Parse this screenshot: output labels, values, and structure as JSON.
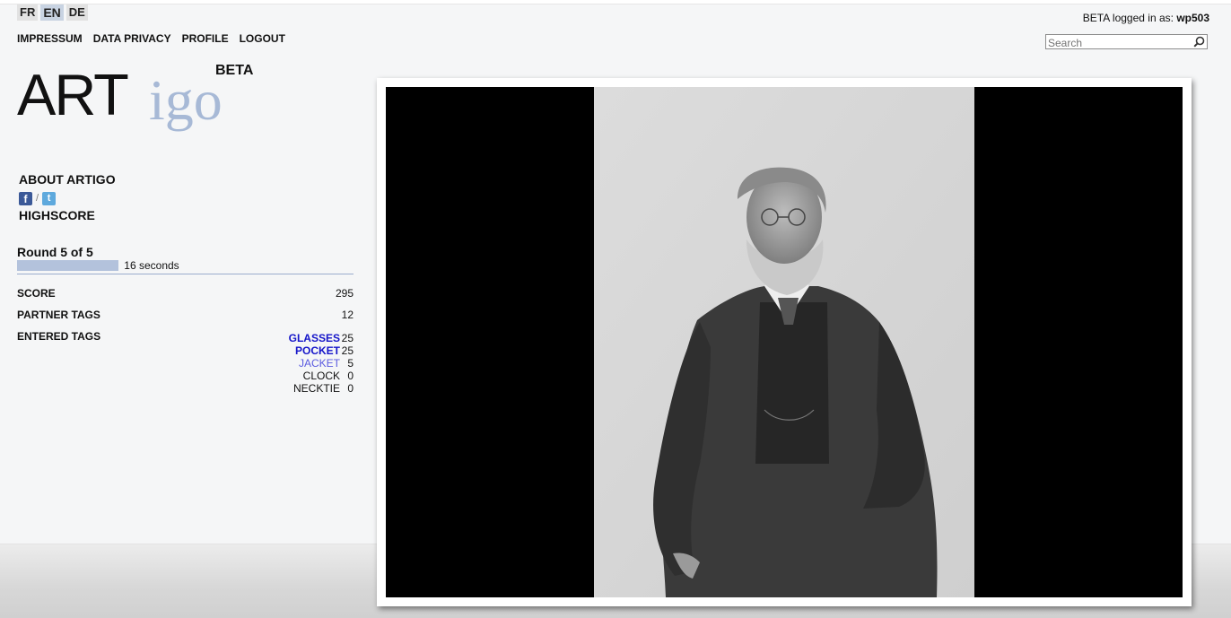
{
  "languages": [
    {
      "code": "FR",
      "active": false
    },
    {
      "code": "EN",
      "active": true
    },
    {
      "code": "DE",
      "active": false
    }
  ],
  "nav": {
    "impressum": "IMPRESSUM",
    "privacy": "DATA PRIVACY",
    "profile": "PROFILE",
    "logout": "LOGOUT"
  },
  "login": {
    "prefix": "BETA logged in as:",
    "user": "wp503"
  },
  "search": {
    "placeholder": "Search"
  },
  "logo": {
    "art": "ART",
    "igo": "igo",
    "beta": "BETA"
  },
  "sidebar": {
    "about": "ABOUT ARTIGO",
    "separator": "/",
    "highscore": "HIGHSCORE"
  },
  "social": {
    "facebook": "f",
    "twitter": "t"
  },
  "game": {
    "round": "Round 5 of 5",
    "timer_text": "16 seconds",
    "timer_fraction": 0.3,
    "score_label": "SCORE",
    "score": "295",
    "partner_label": "PARTNER TAGS",
    "partner_tags": "12",
    "entered_label": "ENTERED TAGS",
    "tags": [
      {
        "name": "GLASSES",
        "points": "25",
        "color": "#1515c9",
        "bold": true
      },
      {
        "name": "POCKET",
        "points": "25",
        "color": "#1515c9",
        "bold": true
      },
      {
        "name": "JACKET",
        "points": "5",
        "color": "#5a5ae0",
        "bold": false
      },
      {
        "name": "CLOCK",
        "points": "0",
        "color": "#111111",
        "bold": false
      },
      {
        "name": "NECKTIE",
        "points": "0",
        "color": "#111111",
        "bold": false
      }
    ]
  },
  "colors": {
    "accent": "#b3c2dc",
    "logo_igo": "#a7b9d6"
  }
}
